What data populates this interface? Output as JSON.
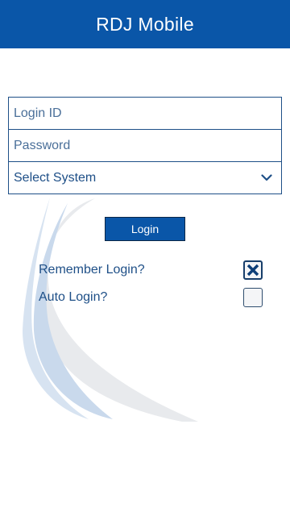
{
  "header": {
    "title": "RDJ Mobile"
  },
  "form": {
    "login_id_placeholder": "Login ID",
    "password_placeholder": "Password",
    "system_select_label": "Select System"
  },
  "login_button_label": "Login",
  "options": {
    "remember_login": {
      "label": "Remember Login?",
      "checked": true
    },
    "auto_login": {
      "label": "Auto Login?",
      "checked": false
    }
  },
  "colors": {
    "brand": "#0a56a8",
    "text": "#1e4f87"
  },
  "icons": {
    "select": "chevron-down-icon",
    "checked": "x-check-icon"
  }
}
